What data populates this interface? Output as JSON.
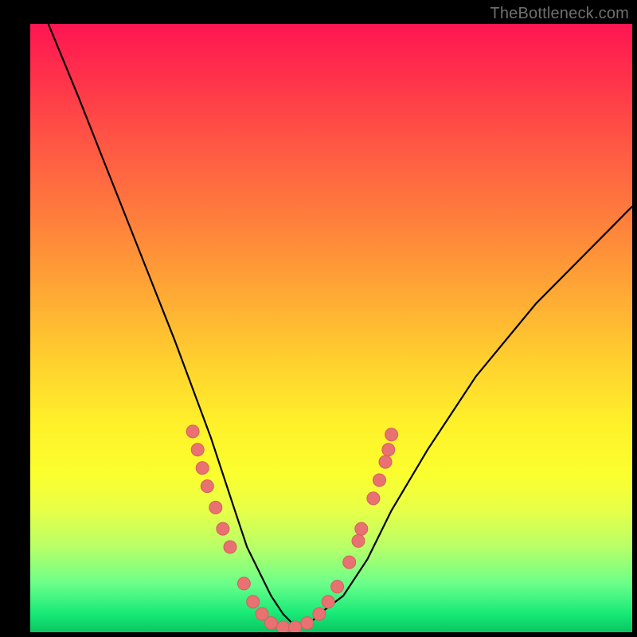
{
  "watermark": "TheBottleneck.com",
  "colors": {
    "curve": "#000000",
    "marker_fill": "#e97171",
    "marker_stroke": "#d55f5f",
    "frame": "#000000"
  },
  "chart_data": {
    "type": "line",
    "title": "",
    "xlabel": "",
    "ylabel": "",
    "xlim": [
      0,
      100
    ],
    "ylim": [
      0,
      100
    ],
    "grid": false,
    "legend": false,
    "series": [
      {
        "name": "bottleneck-curve",
        "x": [
          3,
          8,
          12,
          16,
          20,
          24,
          27,
          30,
          32,
          34,
          36,
          38,
          40,
          42,
          44,
          46,
          48,
          52,
          56,
          60,
          66,
          74,
          84,
          96,
          100
        ],
        "y": [
          100,
          88,
          78,
          68,
          58,
          48,
          40,
          32,
          26,
          20,
          14,
          10,
          6,
          3,
          1,
          1,
          3,
          6,
          12,
          20,
          30,
          42,
          54,
          66,
          70
        ]
      }
    ],
    "markers": [
      {
        "x": 27.0,
        "y": 33.0
      },
      {
        "x": 27.8,
        "y": 30.0
      },
      {
        "x": 28.6,
        "y": 27.0
      },
      {
        "x": 29.4,
        "y": 24.0
      },
      {
        "x": 30.8,
        "y": 20.5
      },
      {
        "x": 32.0,
        "y": 17.0
      },
      {
        "x": 33.2,
        "y": 14.0
      },
      {
        "x": 35.5,
        "y": 8.0
      },
      {
        "x": 37.0,
        "y": 5.0
      },
      {
        "x": 38.5,
        "y": 3.0
      },
      {
        "x": 40.0,
        "y": 1.5
      },
      {
        "x": 42.0,
        "y": 0.8
      },
      {
        "x": 44.0,
        "y": 0.8
      },
      {
        "x": 46.0,
        "y": 1.5
      },
      {
        "x": 48.0,
        "y": 3.0
      },
      {
        "x": 49.5,
        "y": 5.0
      },
      {
        "x": 51.0,
        "y": 7.5
      },
      {
        "x": 53.0,
        "y": 11.5
      },
      {
        "x": 54.5,
        "y": 15.0
      },
      {
        "x": 55.0,
        "y": 17.0
      },
      {
        "x": 57.0,
        "y": 22.0
      },
      {
        "x": 58.0,
        "y": 25.0
      },
      {
        "x": 59.0,
        "y": 28.0
      },
      {
        "x": 59.5,
        "y": 30.0
      },
      {
        "x": 60.0,
        "y": 32.5
      }
    ],
    "marker_radius": 8
  }
}
